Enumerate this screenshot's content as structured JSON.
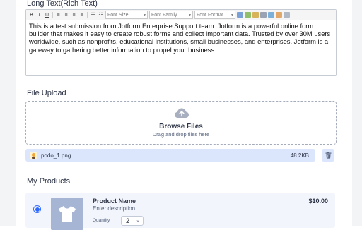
{
  "long_text": {
    "label": "Long Text(Rich Text)",
    "toolbar": {
      "bold": "B",
      "italic": "I",
      "underline": "U",
      "font_size": "Font Size...",
      "font_family": "Font Family...",
      "font_format": "Font Format"
    },
    "content": "This is a test submission from Jotform Enterprise Support team. Jotform is a powerful online form builder that makes it easy to create robust forms and collect important data. Trusted by over 30M users worldwide, such as nonprofits, educational institutions, small businesses, and enterprises, Jotform is a gateway to gathering better information to propel your business."
  },
  "file_upload": {
    "label": "File Upload",
    "title": "Browse Files",
    "subtitle": "Drag and drop files here",
    "file": {
      "name": "podo_1.png",
      "size": "48.2KB"
    }
  },
  "products": {
    "label": "My Products",
    "items": [
      {
        "name": "Product Name",
        "description": "Enter description",
        "price": "$10.00",
        "quantity_label": "Quantity",
        "quantity": "2",
        "selected": true
      }
    ]
  },
  "colors": {
    "accent": "#2e69ff",
    "file_row": "#dbe5fb",
    "product_image": "#a6b5d4"
  },
  "icons": [
    "upload-cloud-icon",
    "trash-icon",
    "t-shirt-icon",
    "file-thumbnail-icon"
  ]
}
